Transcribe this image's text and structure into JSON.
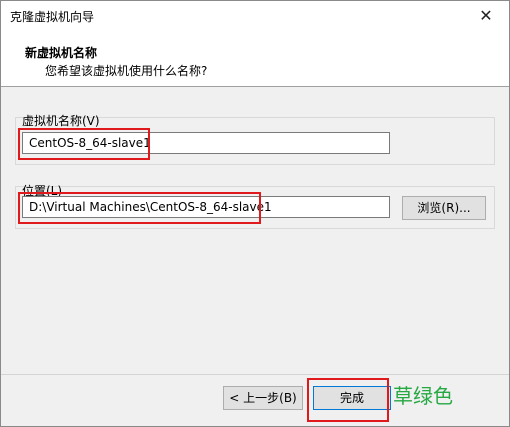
{
  "window": {
    "title": "克隆虚拟机向导",
    "close_glyph": "✕"
  },
  "header": {
    "title": "新虚拟机名称",
    "subtitle": "您希望该虚拟机使用什么名称?"
  },
  "name_group": {
    "label": "虚拟机名称(V)",
    "value": "CentOS-8_64-slave1"
  },
  "location_group": {
    "label": "位置(L)",
    "value": "D:\\Virtual Machines\\CentOS-8_64-slave1",
    "browse_label": "浏览(R)..."
  },
  "footer": {
    "back_label": "< 上一步(B)",
    "finish_label": "完成"
  },
  "watermark": {
    "text": "草绿色"
  },
  "colors": {
    "highlight": "#e0191c",
    "watermark": "#26a843"
  }
}
